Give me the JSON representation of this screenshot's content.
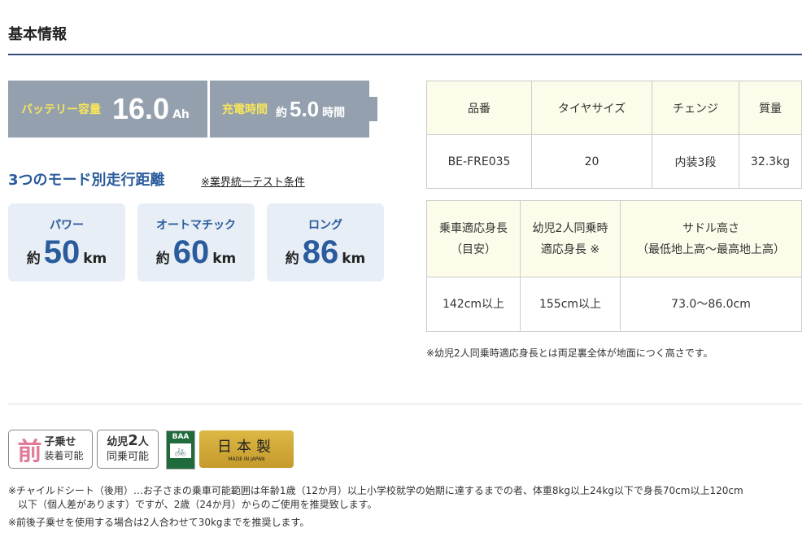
{
  "title": "基本情報",
  "battery": {
    "label": "バッテリー容量",
    "value": "16.0",
    "unit": "Ah"
  },
  "charge": {
    "label": "充電時間",
    "prefix": "約",
    "value": "5.0",
    "unit": "時間"
  },
  "modes": {
    "heading": "3つのモード別走行距離",
    "note": "※業界統一テスト条件",
    "prefix": "約",
    "unit": "km",
    "items": [
      {
        "name": "パワー",
        "value": "50"
      },
      {
        "name": "オートマチック",
        "value": "60"
      },
      {
        "name": "ロング",
        "value": "86"
      }
    ]
  },
  "spec1": {
    "headers": [
      "品番",
      "タイヤサイズ",
      "チェンジ",
      "質量"
    ],
    "values": [
      "BE-FRE035",
      "20",
      "内装3段",
      "32.3kg"
    ]
  },
  "spec2": {
    "headers": [
      [
        "乗車適応身長",
        "（目安）"
      ],
      [
        "幼児2人同乗時",
        "適応身長 ※"
      ],
      [
        "サドル高さ",
        "（最低地上高〜最高地上高）"
      ]
    ],
    "values": [
      "142cm以上",
      "155cm以上",
      "73.0〜86.0cm"
    ]
  },
  "spec_note": "※幼児2人同乗時適応身長とは両足裏全体が地面につく高さです。",
  "badges": {
    "front": {
      "big": "前",
      "l1": "子乗せ",
      "l2": "装着可能"
    },
    "two": {
      "l1": "幼児",
      "num": "2",
      "l1b": "人",
      "l2": "同乗可能"
    },
    "baa": "BAA",
    "japan": {
      "main": "日本製",
      "sub": "MADE IN JAPAN"
    }
  },
  "footnotes": [
    "※チャイルドシート（後用）…お子さまの乗車可能範囲は年齢1歳（12か月）以上小学校就学の始期に達するまでの者、体重8kg以上24kg以下で身長70cm以上120cm",
    "以下（個人差があります）ですが、2歳（24か月）からのご使用を推奨致します。",
    "※前後子乗せを使用する場合は2人合わせて30kgまでを推奨します。"
  ]
}
